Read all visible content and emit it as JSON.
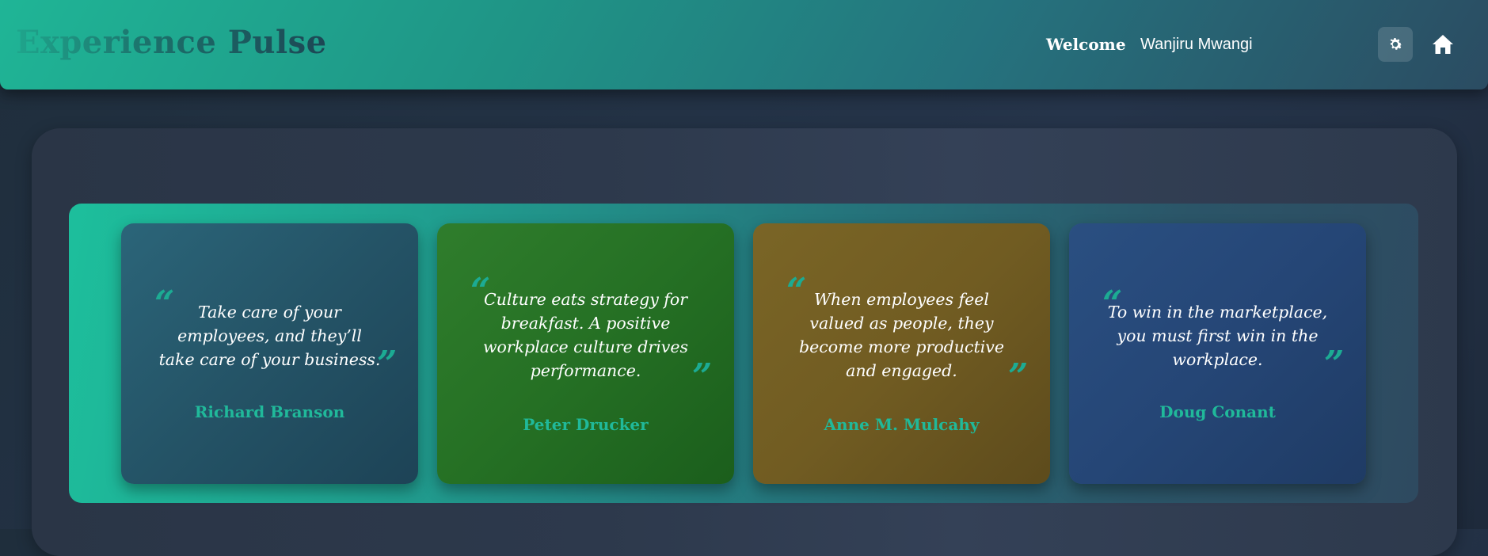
{
  "header": {
    "brand": "Experience Pulse",
    "welcome_label": "Welcome",
    "user_name": "Wanjiru Mwangi",
    "settings_icon": "gear-icon",
    "home_icon": "home-icon"
  },
  "colors": {
    "accent": "#1fb596",
    "author_text": "#20b99a",
    "background": "#1f2e3c"
  },
  "quotes": [
    {
      "lines": [
        "Take care of your",
        "employees, and they’ll",
        "take care of your business."
      ],
      "author": "Richard Branson"
    },
    {
      "lines": [
        "Culture eats strategy for",
        "breakfast. A positive",
        "workplace culture drives",
        "performance."
      ],
      "author": "Peter Drucker"
    },
    {
      "lines": [
        "When employees feel",
        "valued as people, they",
        "become more productive",
        "and engaged."
      ],
      "author": "Anne M. Mulcahy"
    },
    {
      "lines": [
        "To win in the marketplace,",
        "you must first win in the",
        "workplace."
      ],
      "author": "Doug Conant"
    }
  ],
  "quote_marks": {
    "open": "“",
    "close": "”"
  }
}
